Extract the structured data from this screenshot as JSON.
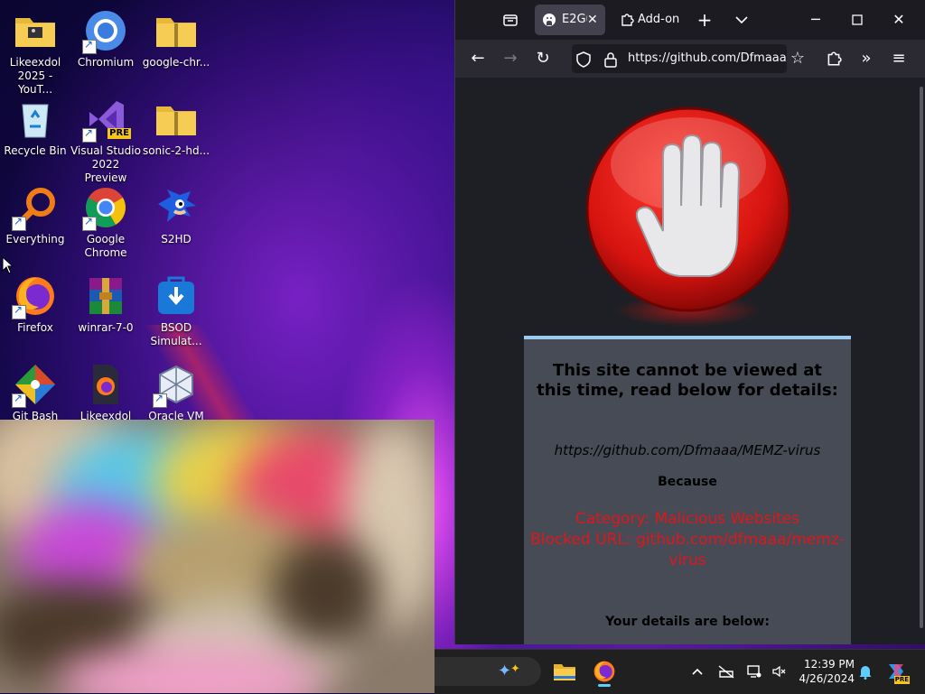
{
  "desktop": {
    "icons": [
      {
        "label": "Likeexdol 2025 - YouT...",
        "icon": "folder-icon"
      },
      {
        "label": "Chromium",
        "icon": "chromium-icon"
      },
      {
        "label": "google-chr...",
        "icon": "zip-folder-icon"
      },
      {
        "label": "Recycle Bin",
        "icon": "recycle-bin-icon"
      },
      {
        "label": "Visual Studio 2022 Preview",
        "icon": "visual-studio-icon",
        "badge": "PRE"
      },
      {
        "label": "sonic-2-hd...",
        "icon": "zip-folder-icon"
      },
      {
        "label": "Everything",
        "icon": "magnifier-icon"
      },
      {
        "label": "Google Chrome",
        "icon": "chrome-icon"
      },
      {
        "label": "S2HD",
        "icon": "sonic-icon"
      },
      {
        "label": "Firefox",
        "icon": "firefox-icon"
      },
      {
        "label": "winrar-7-0",
        "icon": "winrar-icon"
      },
      {
        "label": "BSOD Simulat...",
        "icon": "download-bag-icon"
      },
      {
        "label": "Git Bash",
        "icon": "git-icon"
      },
      {
        "label": "Likeexdol",
        "icon": "firefox-file-icon"
      },
      {
        "label": "Oracle VM",
        "icon": "virtualbox-icon"
      }
    ]
  },
  "browser": {
    "tabs": [
      {
        "label": "E2Gu",
        "icon": "github-icon",
        "active": true
      },
      {
        "label": "Add-on",
        "icon": "puzzle-icon",
        "active": false
      }
    ],
    "url": "https://github.com/Dfmaaa/",
    "colors": {
      "tabbar": "#1c1b22",
      "toolbar": "#2b2a33",
      "content": "#1e1f24",
      "stop": "#e0161b",
      "panel": "#474b56"
    }
  },
  "block_page": {
    "heading": "This site cannot be viewed at this time, read below for details:",
    "url": "https://github.com/Dfmaaa/MEMZ-virus",
    "because": "Because",
    "category": "Category: Malicious Websites",
    "blocked_url": "Blocked URL: github.com/dfmaaa/memz-virus",
    "details": "Your details are below:"
  },
  "taskbar": {
    "apps": [
      "file-explorer-icon",
      "firefox-icon"
    ],
    "tray": [
      "chevron-up-icon",
      "network-off-icon",
      "monitor-icon",
      "speaker-mute-icon",
      "bell-icon",
      "copilot-icon"
    ],
    "copilot_badge": "PRE",
    "time": "12:39 PM",
    "date": "4/26/2024"
  }
}
